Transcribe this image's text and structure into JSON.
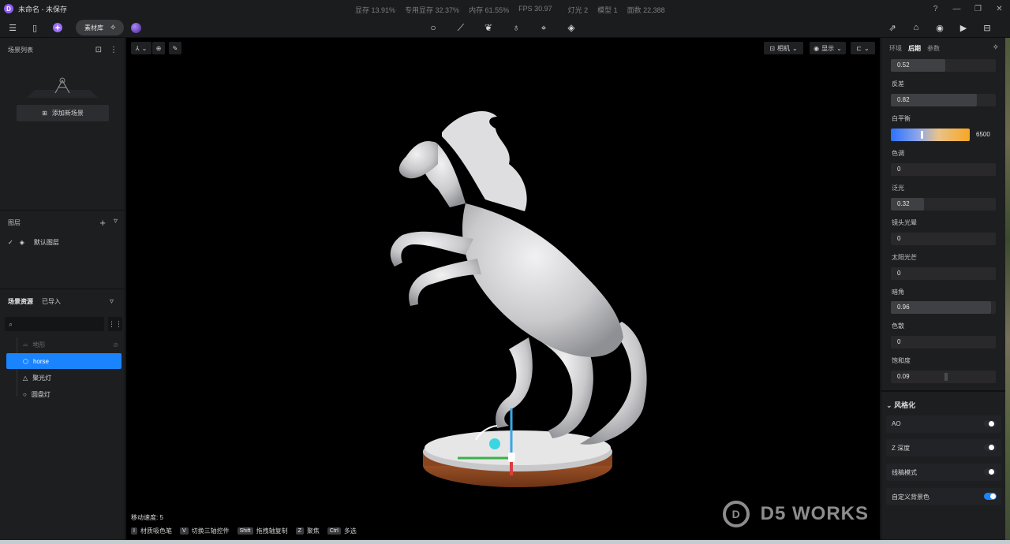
{
  "app": {
    "title": "未命名 - 未保存",
    "logo": "D"
  },
  "stats": {
    "vram": "显存 13.91%",
    "dedicated_vram": "专用显存 32.37%",
    "memory": "内存 61.55%",
    "fps": "FPS 30.97",
    "lights": "灯光 2",
    "models": "模型 1",
    "faces": "面数 22,388"
  },
  "toolbar": {
    "library_label": "素材库"
  },
  "left": {
    "scene_list_title": "场景列表",
    "add_scene_label": "添加新场景",
    "layers_title": "图层",
    "default_layer": "默认图层",
    "assets_tab_scene": "场景资源",
    "assets_tab_imported": "已导入",
    "items": [
      {
        "label": "地形",
        "icon": "terrain-icon"
      },
      {
        "label": "horse",
        "icon": "cube-icon"
      },
      {
        "label": "聚光灯",
        "icon": "spotlight-icon"
      },
      {
        "label": "圆盘灯",
        "icon": "disk-light-icon"
      }
    ]
  },
  "viewport": {
    "camera_label": "相机",
    "display_label": "显示",
    "move_speed": "移动速度: 5",
    "shortcuts": [
      {
        "key": "I",
        "label": "材质吸色笔"
      },
      {
        "key": "V",
        "label": "切换三轴控件"
      },
      {
        "key": "Shift",
        "label": "拖拽轴复制"
      },
      {
        "key": "Z",
        "label": "聚焦"
      },
      {
        "key": "Ctrl",
        "label": "多选"
      }
    ],
    "watermark": "D5 WORKS"
  },
  "right": {
    "tabs": [
      "环境",
      "后期",
      "参数"
    ],
    "active_tab": "后期",
    "top_value": "0.52",
    "props": [
      {
        "label": "反差",
        "value": "0.82",
        "fraction": 0.82
      },
      {
        "label": "色调",
        "value": "0",
        "fraction": 0
      },
      {
        "label": "泛光",
        "value": "0.32",
        "fraction": 0.32
      },
      {
        "label": "镜头光晕",
        "value": "0",
        "fraction": 0
      },
      {
        "label": "太阳光芒",
        "value": "0",
        "fraction": 0
      },
      {
        "label": "暗角",
        "value": "0.96",
        "fraction": 0.96
      },
      {
        "label": "色散",
        "value": "0",
        "fraction": 0
      },
      {
        "label": "饱和度",
        "value": "0.09",
        "fraction": 0.52
      }
    ],
    "white_balance": {
      "label": "白平衡",
      "value": "6500"
    },
    "stylize_title": "风格化",
    "toggles": [
      {
        "label": "AO",
        "on": false
      },
      {
        "label": "Z 深度",
        "on": false
      },
      {
        "label": "线稿模式",
        "on": false
      },
      {
        "label": "自定义背景色",
        "on": true
      }
    ]
  },
  "colors": {
    "accent": "#1a84ff",
    "viewport_bg": "#000000"
  }
}
